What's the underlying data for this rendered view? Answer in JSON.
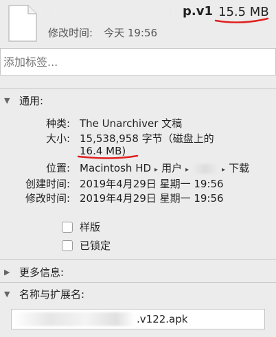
{
  "header": {
    "file_name": "p.v1",
    "file_size": "15.5 MB",
    "modified_label": "修改时间:",
    "modified_value": "今天 19:56"
  },
  "tags": {
    "placeholder": "添加标签..."
  },
  "general": {
    "title": "通用:",
    "kind_label": "种类:",
    "kind_value": "The Unarchiver 文稿",
    "size_label": "大小:",
    "size_value_line1": "15,538,958 字节（磁盘上的",
    "size_value_line2": "16.4 MB)",
    "where_label": "位置:",
    "where_path": [
      "Macintosh HD",
      "用户",
      "下载"
    ],
    "created_label": "创建时间:",
    "created_value": "2019年4月29日 星期一 19:56",
    "modified_label": "修改时间:",
    "modified_value": "2019年4月29日 星期一 19:56",
    "stationery_label": "样版",
    "locked_label": "已锁定"
  },
  "more_info": {
    "title": "更多信息:"
  },
  "name_ext": {
    "title": "名称与扩展名:",
    "name_value": ".v122.apk"
  },
  "colors": {
    "annotation_red": "#e02020",
    "background": "#ececec"
  }
}
